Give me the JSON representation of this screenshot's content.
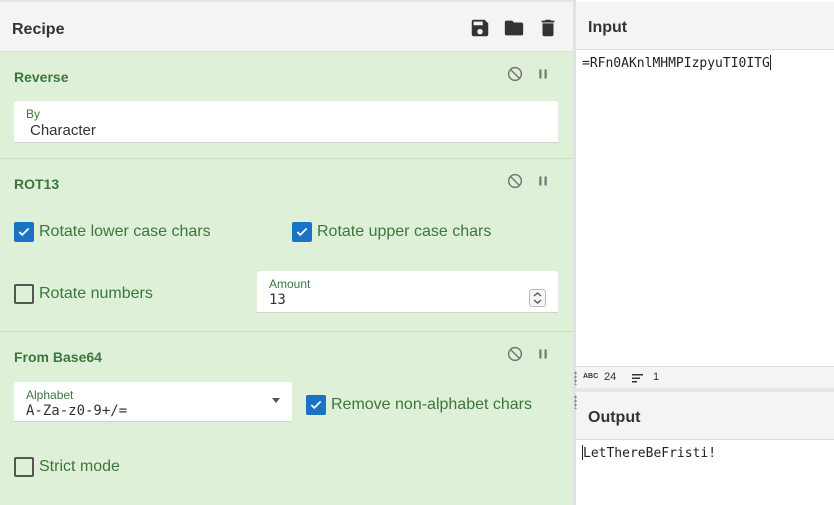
{
  "recipe": {
    "title": "Recipe",
    "icons": {
      "save": "save-icon",
      "load": "folder-icon",
      "clear": "trash-icon"
    },
    "operations": [
      {
        "name": "Reverse",
        "by_label": "By",
        "by_value": "Character"
      },
      {
        "name": "ROT13",
        "rotate_lower_label": "Rotate lower case chars",
        "rotate_lower_checked": true,
        "rotate_upper_label": "Rotate upper case chars",
        "rotate_upper_checked": true,
        "rotate_numbers_label": "Rotate numbers",
        "rotate_numbers_checked": false,
        "amount_label": "Amount",
        "amount_value": "13"
      },
      {
        "name": "From Base64",
        "alphabet_label": "Alphabet",
        "alphabet_value": "A-Za-z0-9+/=",
        "remove_nonalpha_label": "Remove non-alphabet chars",
        "remove_nonalpha_checked": true,
        "strict_mode_label": "Strict mode",
        "strict_mode_checked": false
      }
    ]
  },
  "input": {
    "title": "Input",
    "text": "=RFn0AKnlMHMPIzpyuTI0ITG",
    "status": {
      "length_icon": "abc-icon",
      "length": "24",
      "lines_icon": "lines-icon",
      "lines": "1"
    }
  },
  "output": {
    "title": "Output",
    "text": "LetThereBeFristi!"
  },
  "colors": {
    "op_background": "#dff0d8",
    "op_text": "#3c763d",
    "checkbox": "#1a73c4"
  }
}
